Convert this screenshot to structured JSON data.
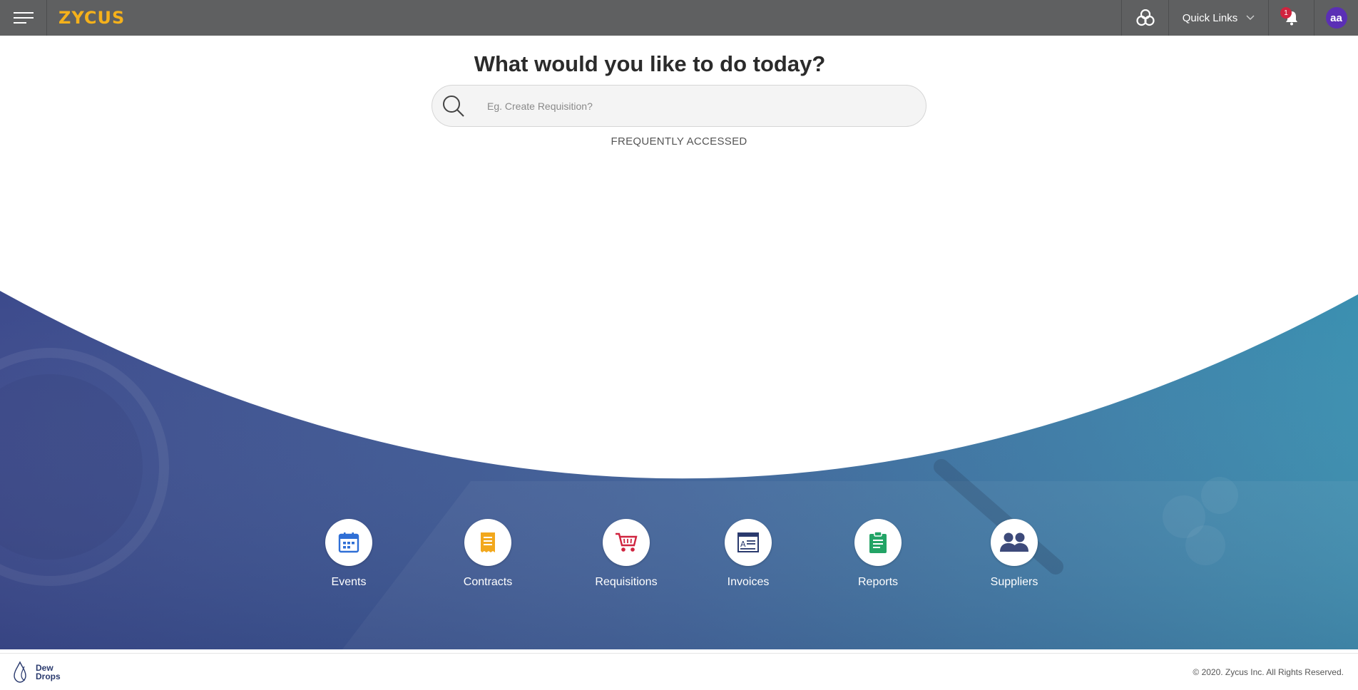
{
  "header": {
    "logo": "ZYCUS",
    "quick_links_label": "Quick Links",
    "notification_count": "1",
    "avatar_initials": "aa"
  },
  "hero": {
    "title": "What would you like to do today?",
    "search_placeholder": "Eg. Create Requisition?",
    "frequently_accessed_label": "FREQUENTLY ACCESSED"
  },
  "tiles": [
    {
      "label": "Events",
      "icon": "calendar-icon",
      "color": "#2f6fd6"
    },
    {
      "label": "Contracts",
      "icon": "contract-icon",
      "color": "#f2a81d"
    },
    {
      "label": "Requisitions",
      "icon": "cart-icon",
      "color": "#d0243f"
    },
    {
      "label": "Invoices",
      "icon": "invoice-icon",
      "color": "#2a3a6e"
    },
    {
      "label": "Reports",
      "icon": "report-icon",
      "color": "#23a466"
    },
    {
      "label": "Suppliers",
      "icon": "users-icon",
      "color": "#3d4a7a"
    }
  ],
  "footer": {
    "brand_line1": "Dew",
    "brand_line2": "Drops",
    "copyright": "© 2020. Zycus Inc. All Rights Reserved."
  },
  "colors": {
    "topbar": "#5f6061",
    "brand": "#f5b11b",
    "banner_left": "#3c4a8c",
    "banner_right": "#3a8fb0"
  }
}
